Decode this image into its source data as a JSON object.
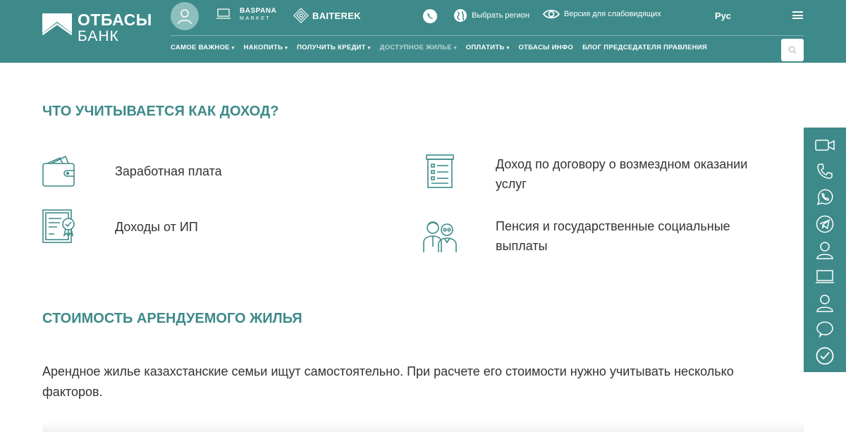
{
  "header": {
    "logo": {
      "line1": "ОТБАСЫ",
      "line2": "БАНК"
    },
    "partners": {
      "baspana_line1": "BASPANA",
      "baspana_line2": "MARKET",
      "baiterek": "BAITEREK"
    },
    "region_label": "Выбрать регион",
    "accessibility_label": "Версия для слабовидящих",
    "language": "Рус",
    "nav": [
      {
        "label": "САМОЕ ВАЖНОЕ",
        "has_menu": true
      },
      {
        "label": "НАКОПИТЬ",
        "has_menu": true
      },
      {
        "label": "ПОЛУЧИТЬ КРЕДИТ",
        "has_menu": true
      },
      {
        "label": "ДОСТУПНОЕ ЖИЛЬЕ",
        "has_menu": true,
        "active": true
      },
      {
        "label": "ОПЛАТИТЬ",
        "has_menu": true
      },
      {
        "label": "ОТБАСЫ ИНФО",
        "has_menu": false
      },
      {
        "label": "БЛОГ ПРЕДСЕДАТЕЛЯ ПРАВЛЕНИЯ",
        "has_menu": false
      }
    ],
    "caret": "▾"
  },
  "main": {
    "income_title": "ЧТО УЧИТЫВАЕТСЯ КАК ДОХОД?",
    "income_items": [
      {
        "label": "Заработная плата",
        "icon": "wallet-icon"
      },
      {
        "label": "Доход по договору о возмездном оказании услуг",
        "icon": "contract-icon"
      },
      {
        "label": "Доходы от ИП",
        "icon": "certificate-icon"
      },
      {
        "label": "Пенсия и государственные социальные выплаты",
        "icon": "elderly-couple-icon"
      }
    ],
    "rent_title": "СТОИМОСТЬ АРЕНДУЕМОГО ЖИЛЬЯ",
    "rent_text": "Арендное жилье казахстанские семьи ищут самостоятельно. При расчете его стоимости нужно учитывать несколько факторов."
  },
  "sidebar_icons": [
    "video-call-icon",
    "phone-icon",
    "whatsapp-icon",
    "telegram-icon",
    "user-icon",
    "laptop-icon",
    "person-icon",
    "chat-icon",
    "check-icon"
  ],
  "colors": {
    "brand": "#3e8a8a",
    "brand_light": "#8dbfbd",
    "text": "#333333",
    "nav_muted": "#b8d6d4"
  }
}
